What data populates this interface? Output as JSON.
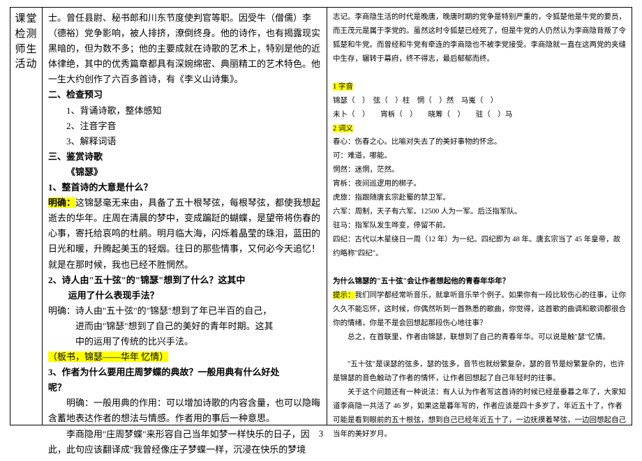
{
  "label": {
    "l1": "课堂",
    "l2": "检测",
    "l3": "师生",
    "l4": "活动"
  },
  "left": {
    "p1": "士。曾任县尉、秘书郎和川东节度使判官等职。因受牛（僧儒）李（德裕）党争影响，被人排挤，潦倒终身。他的诗作，也有揭露现实黑暗的，但为数不多；他的主要成就在诗歌的艺术上，特别是他的近体律绝，其中的优秀篇章都具有深婉绵密、典丽精工的艺术特色。他一生大约创作了六百多首诗，有《李义山诗集》。",
    "h2": "二、检查预习",
    "h2_1": "1、背诵诗歌，整体感知",
    "h2_2": "2、注音字音",
    "h2_3": "3、解释词语",
    "h3": "三、鉴赏诗歌",
    "title": "《锦瑟》",
    "q1": "1、整首诗的大意是什么？",
    "q1_label": "明确：",
    "q1_ans": "这锦瑟毫无来由，具备了五十根琴弦，每根琴弦，都使我想起逝去的华年。庄周在清晨的梦中，变成蹁跹的蝴蝶，是望帝将伤春的心事，寄托给哀鸣的杜鹃。明月临大海，闪烁着晶莹的珠泪，蓝田的日光和暖，升腾起美玉的轻烟。往日的那些情事，又何必今天追忆！就是在那时候，我也已经不胜惘然。",
    "q2a": "2、诗人由\"五十弦\"的\"锦瑟\"想到了什么？这其中",
    "q2b": "运用了什么表现手法？",
    "q2_ans1": "明确：诗人由\"五十弦\"的\"锦瑟\"想到了年已半百的自己，",
    "q2_ans2": "进而由\"锦瑟\"想到了自己的美好的青年时期。这其",
    "q2_ans3": "中的运用了传统的比兴手法。",
    "board": "（板书，锦瑟——华年  忆情）",
    "q3a": "3、作者为什么要用庄周梦蝶的典故？一般用典有什么好处",
    "q3b": "呢？",
    "q3_ans1": "明确：一般用典的作用：可以增加诗歌的内容含量，也可以隐晦含蓄地表达作者的想法与情感。作者用的事后一种意思。",
    "q3_ans2": "李商隐用\"庄周梦蝶\"来形容自己当年如梦一样快乐的日子，因此，此句应该翻译成\"我曾经像庄子梦蝶一样，沉浸在快乐的梦境"
  },
  "right": {
    "p1": "志记。李商隐生活的时代是晚唐，晚唐时期的党争是特别严重的，令狐楚他是牛党的要员，而王茂元是属于李党的。虽然这时令狐楚已经死了，但是牛党的人仍然认为李商隐背叛了令狐楚和牛党。而曾经和牛党有牵连的李商隐也不被李党接受。李商隐就一直在这两党的夹缝中生存，辗转于幕府，终不得志，最后郁郁而终。",
    "h1_label": "1 字音",
    "h1_line1": "锦瑟（　）　弦（　）柱　惘（　）然　马嵬（　）",
    "h1_line2": "未卜（　）　　宵柝（　）　　晓筹（　）　　驻（　）马",
    "h2_label": "2 词义",
    "h2_1": "春心：伤春之心。比喻对失去了的美好事物的怀念。",
    "h2_2": "可：难道，哪能。",
    "h2_3": "惘然：迷惘，茫然。",
    "h2_4": "宵柝：夜间巡逻用的梆子。",
    "h2_5": "虎旅：指跟随唐玄宗赴蜀的禁卫军。",
    "h2_6": "六军：周制，天子有六军。12500 人为一军。后泛指军队。",
    "h2_7": "驻马：指军队发生哗变，停留不前。",
    "h2_8": "四纪：古代以木星绕日一周（12 年）为一纪。四纪即为 48 年。唐玄宗当了 45 年皇帝，故约略称\"四纪\"。",
    "q": "为什么锦瑟的\"五十弦\"会让作者想起他的青春年华年？",
    "tip_label": "提示：",
    "tip": "我们同学都经常听音乐，就拿听音乐举个例子。如果你有一段比较伤心的往事，让你久久不能忘怀，这时候，你偶然听到一首熟悉的歌曲，你觉得，这首歌的曲调和歌词都很合你的情绪，你是不是会回想起那段伤心地往事？",
    "sum": "总之，在首联里，作者由锦瑟，联想到了自己的青春年华。可以说是触\"瑟\"忆情。",
    "p2": "\"五十弦\"是误瑟的弦多，瑟的弦多，音节也就纷繁复杂，瑟的音节是纷繁复杂的，也许是锦瑟的音色触动了作者的情怀，让作者回想起了自己年轻时的往事。",
    "p3": "关于这个问题还有一种说法：有人认为作者写这首诗的时候已经是垂暮之年了，大家知道李商隐一共活了 46 岁，如果这是暮年写的，作者应该是四十多岁了，年近五十了，作者可能是看到眼前的五十根弦，想到自己已经年近五十了，一边抚摸着琴弦，一边回想起自己当年的美好岁月。"
  },
  "page_number": "3"
}
